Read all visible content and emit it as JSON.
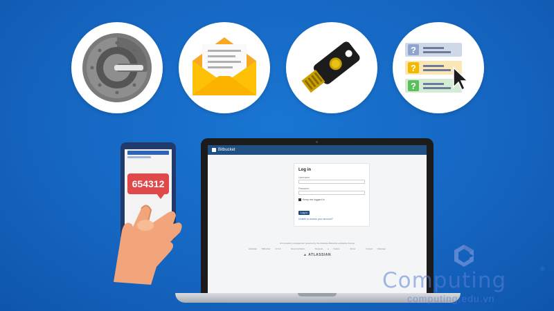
{
  "colors": {
    "background": "#1565c0",
    "bitbucket_nav": "#205081",
    "otp_bubble": "#e0484a",
    "envelope": "#f9a825"
  },
  "icons": {
    "authenticator": "google-authenticator-icon",
    "email": "email-envelope-icon",
    "security_key": "usb-security-key-icon",
    "questions": "security-questions-icon"
  },
  "phone": {
    "otp_code": "654312"
  },
  "bitbucket": {
    "brand": "Bitbucket",
    "login_title": "Log in",
    "username_label": "Username",
    "password_label": "Password",
    "remember_label": "Keep me logged in",
    "login_button": "Log in",
    "forgot_link": "Unable to access your account?",
    "footer_text": "Git repository management powered by the Atlassian Bitbucket evaluation license",
    "footer_links": "Atlassian Bitbucket v7.6.0 · Documentation · Request a feature · About · Contact Atlassian",
    "atlassian_label": "ATLASSIAN"
  },
  "watermark": {
    "brand": "Computing",
    "reg": "®",
    "url": "computing.edu.vn"
  }
}
